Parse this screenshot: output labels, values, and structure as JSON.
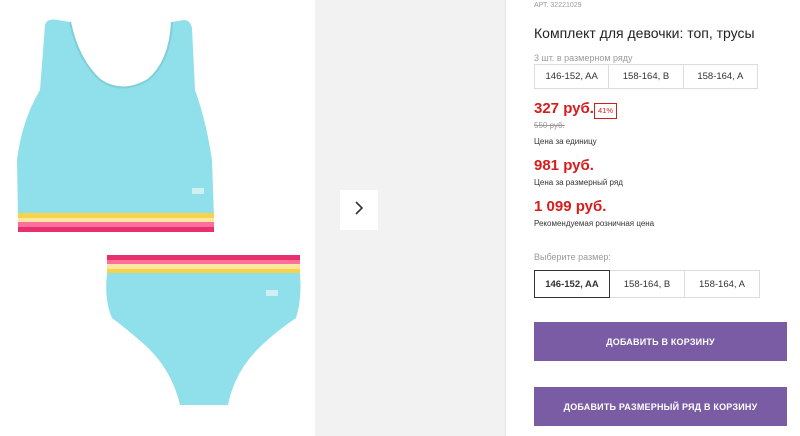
{
  "product": {
    "article": "АРТ. 32221029",
    "title": "Комплект для девочки: топ, трусы",
    "series_count": "3 шт. в размерном ряду",
    "series_sizes": [
      "146-152, AA",
      "158-164, B",
      "158-164, A"
    ]
  },
  "pricing": {
    "price": "327 руб.",
    "discount": "41%",
    "old_price": "550 руб.",
    "unit_label": "Цена за единицу",
    "series_price": "981 руб.",
    "series_label": "Цена за размерный ряд",
    "rrp": "1 099 руб.",
    "rrp_label": "Рекомендуемая розничная цена"
  },
  "size_select": {
    "label": "Выберите размер:",
    "options": [
      "146-152, AA",
      "158-164, B",
      "158-164, A"
    ],
    "selected": "146-152, AA"
  },
  "actions": {
    "add_to_cart": "ДОБАВИТЬ В КОРЗИНУ",
    "add_series_to_cart": "ДОБАВИТЬ РАЗМЕРНЫЙ РЯД В КОРЗИНУ"
  },
  "colors": {
    "accent": "#7a5ca5",
    "price": "#d71c1c",
    "product": "#8fe0ea"
  },
  "icons": {
    "next": "chevron-right-icon"
  }
}
